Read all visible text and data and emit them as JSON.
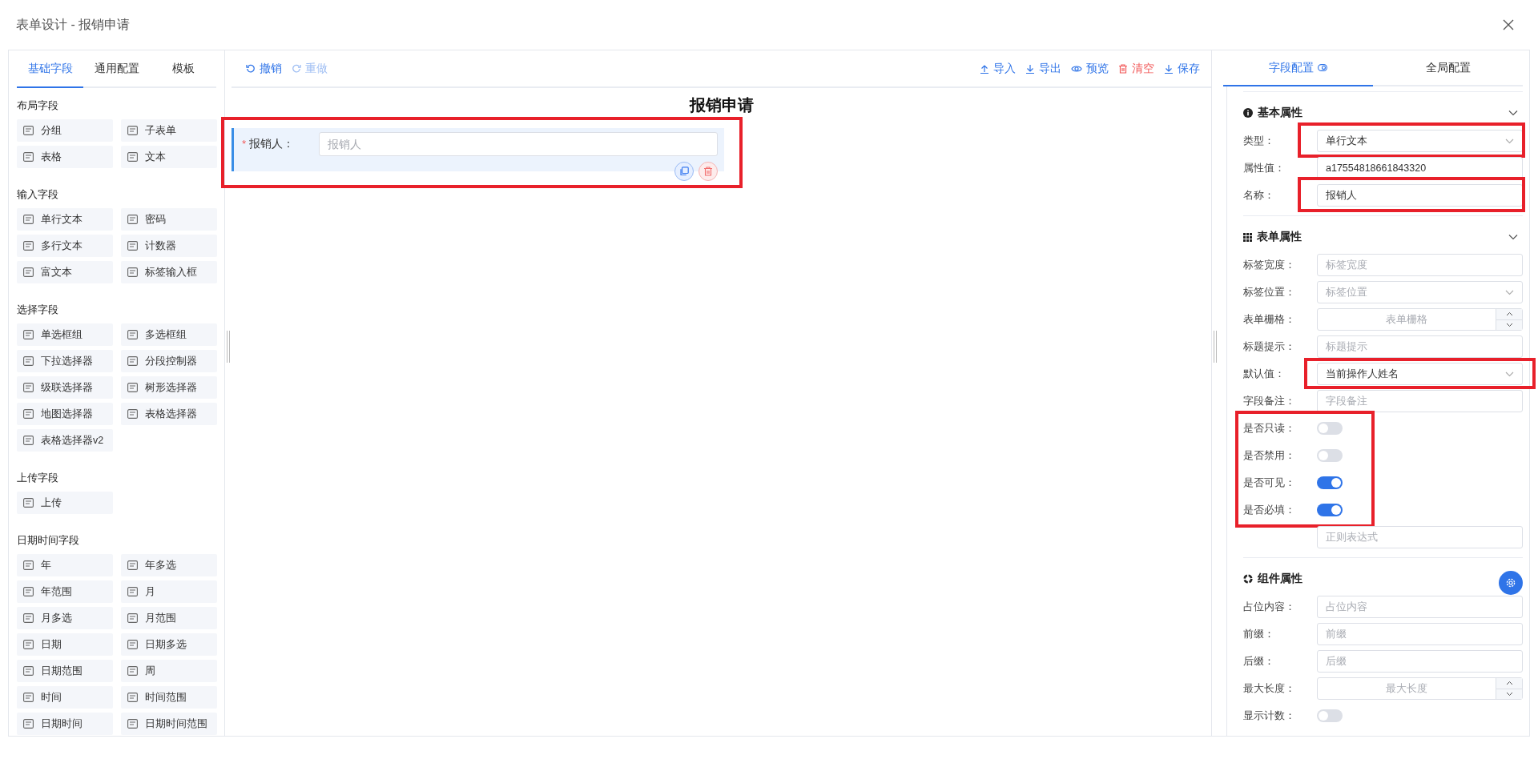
{
  "window": {
    "title": "表单设计 - 报销申请"
  },
  "palette": {
    "tabs": [
      {
        "label": "基础字段",
        "selected": true
      },
      {
        "label": "通用配置",
        "selected": false
      },
      {
        "label": "模板",
        "selected": false
      }
    ],
    "groups": [
      {
        "title": "布局字段",
        "items": [
          "分组",
          "子表单",
          "表格",
          "文本"
        ]
      },
      {
        "title": "输入字段",
        "items": [
          "单行文本",
          "密码",
          "多行文本",
          "计数器",
          "富文本",
          "标签输入框"
        ]
      },
      {
        "title": "选择字段",
        "items": [
          "单选框组",
          "多选框组",
          "下拉选择器",
          "分段控制器",
          "级联选择器",
          "树形选择器",
          "地图选择器",
          "表格选择器",
          "表格选择器v2"
        ]
      },
      {
        "title": "上传字段",
        "items": [
          "上传"
        ]
      },
      {
        "title": "日期时间字段",
        "items": [
          "年",
          "年多选",
          "年范围",
          "月",
          "月多选",
          "月范围",
          "日期",
          "日期多选",
          "日期范围",
          "周",
          "时间",
          "时间范围",
          "日期时间",
          "日期时间范围"
        ]
      }
    ]
  },
  "toolbar": {
    "left": [
      {
        "label": "撤销",
        "kind": "undo",
        "disabled": false
      },
      {
        "label": "重做",
        "kind": "redo",
        "disabled": true
      }
    ],
    "right": [
      {
        "label": "导入",
        "kind": "import"
      },
      {
        "label": "导出",
        "kind": "export"
      },
      {
        "label": "预览",
        "kind": "preview"
      },
      {
        "label": "清空",
        "kind": "clear"
      },
      {
        "label": "保存",
        "kind": "save"
      }
    ]
  },
  "canvas": {
    "title": "报销申请",
    "fields": [
      {
        "label": "报销人：",
        "required_mark": "*",
        "placeholder": "报销人",
        "selected": true,
        "highlighted": true
      }
    ]
  },
  "config": {
    "tabs": [
      {
        "label": "字段配置",
        "selected": true
      },
      {
        "label": "全局配置",
        "selected": false
      }
    ],
    "sections": [
      {
        "title": "基本属性",
        "collapsible": true,
        "rows": [
          {
            "kind": "select",
            "label": "类型：",
            "value": "单行文本",
            "highlighted": true
          },
          {
            "kind": "input",
            "label": "属性值：",
            "value": "a17554818661843320"
          },
          {
            "kind": "input",
            "label": "名称：",
            "value": "报销人",
            "highlighted": true
          }
        ]
      },
      {
        "title": "表单属性",
        "collapsible": true,
        "rows": [
          {
            "kind": "input",
            "label": "标签宽度：",
            "placeholder": "标签宽度"
          },
          {
            "kind": "select",
            "label": "标签位置：",
            "placeholder": "标签位置"
          },
          {
            "kind": "number",
            "label": "表单栅格：",
            "placeholder": "表单栅格"
          },
          {
            "kind": "input",
            "label": "标题提示：",
            "placeholder": "标题提示"
          },
          {
            "kind": "select",
            "label": "默认值：",
            "value": "当前操作人姓名",
            "highlighted": true
          },
          {
            "kind": "input",
            "label": "字段备注：",
            "placeholder": "字段备注"
          },
          {
            "kind": "group",
            "highlighted": true,
            "rows": [
              {
                "kind": "switch",
                "label": "是否只读：",
                "on": false
              },
              {
                "kind": "switch",
                "label": "是否禁用：",
                "on": false
              },
              {
                "kind": "switch",
                "label": "是否可见：",
                "on": true
              },
              {
                "kind": "switch",
                "label": "是否必填：",
                "on": true
              }
            ]
          },
          {
            "kind": "input",
            "placeholder": "正则表达式"
          }
        ]
      },
      {
        "title": "组件属性",
        "collapsible": false,
        "rows": [
          {
            "kind": "input",
            "label": "占位内容：",
            "placeholder": "占位内容"
          },
          {
            "kind": "input",
            "label": "前缀：",
            "placeholder": "前缀"
          },
          {
            "kind": "input",
            "label": "后缀：",
            "placeholder": "后缀"
          },
          {
            "kind": "number",
            "label": "最大长度：",
            "placeholder": "最大长度"
          },
          {
            "kind": "switch",
            "label": "显示计数：",
            "on": false
          }
        ]
      }
    ]
  }
}
